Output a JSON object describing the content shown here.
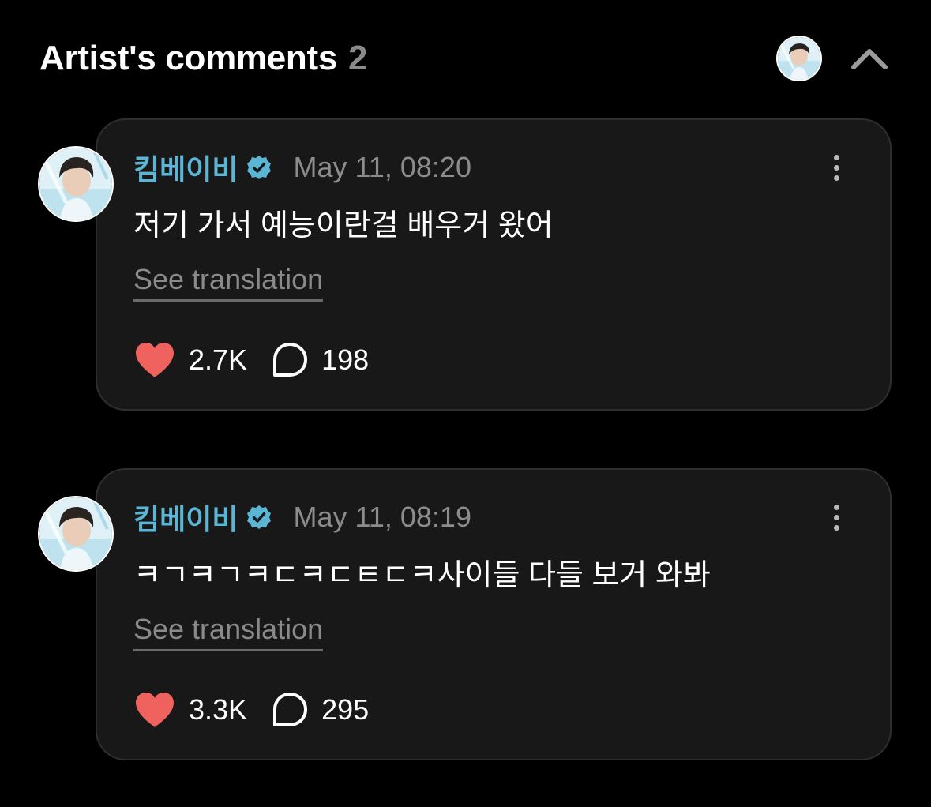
{
  "header": {
    "title": "Artist's comments",
    "count": "2",
    "avatar_icon": "artist-avatar",
    "collapse_icon": "chevron-up-icon"
  },
  "colors": {
    "background": "#000000",
    "card_background": "#181818",
    "author_name": "#5bb6d6",
    "verified_badge": "#5bb6d6",
    "like_heart": "#f0625e",
    "muted_text": "#8a8a8a"
  },
  "comments": [
    {
      "author": "킴베이비",
      "verified": true,
      "timestamp": "May 11, 08:20",
      "text": "저기 가서 예능이란걸 배우거 왔어",
      "translation_link": "See translation",
      "likes": "2.7K",
      "replies": "198"
    },
    {
      "author": "킴베이비",
      "verified": true,
      "timestamp": "May 11, 08:19",
      "text": "ㅋㄱㅋㄱㅋㄷㅋㄷㅌㄷㅋ사이들 다들 보거 와봐",
      "translation_link": "See translation",
      "likes": "3.3K",
      "replies": "295"
    }
  ]
}
